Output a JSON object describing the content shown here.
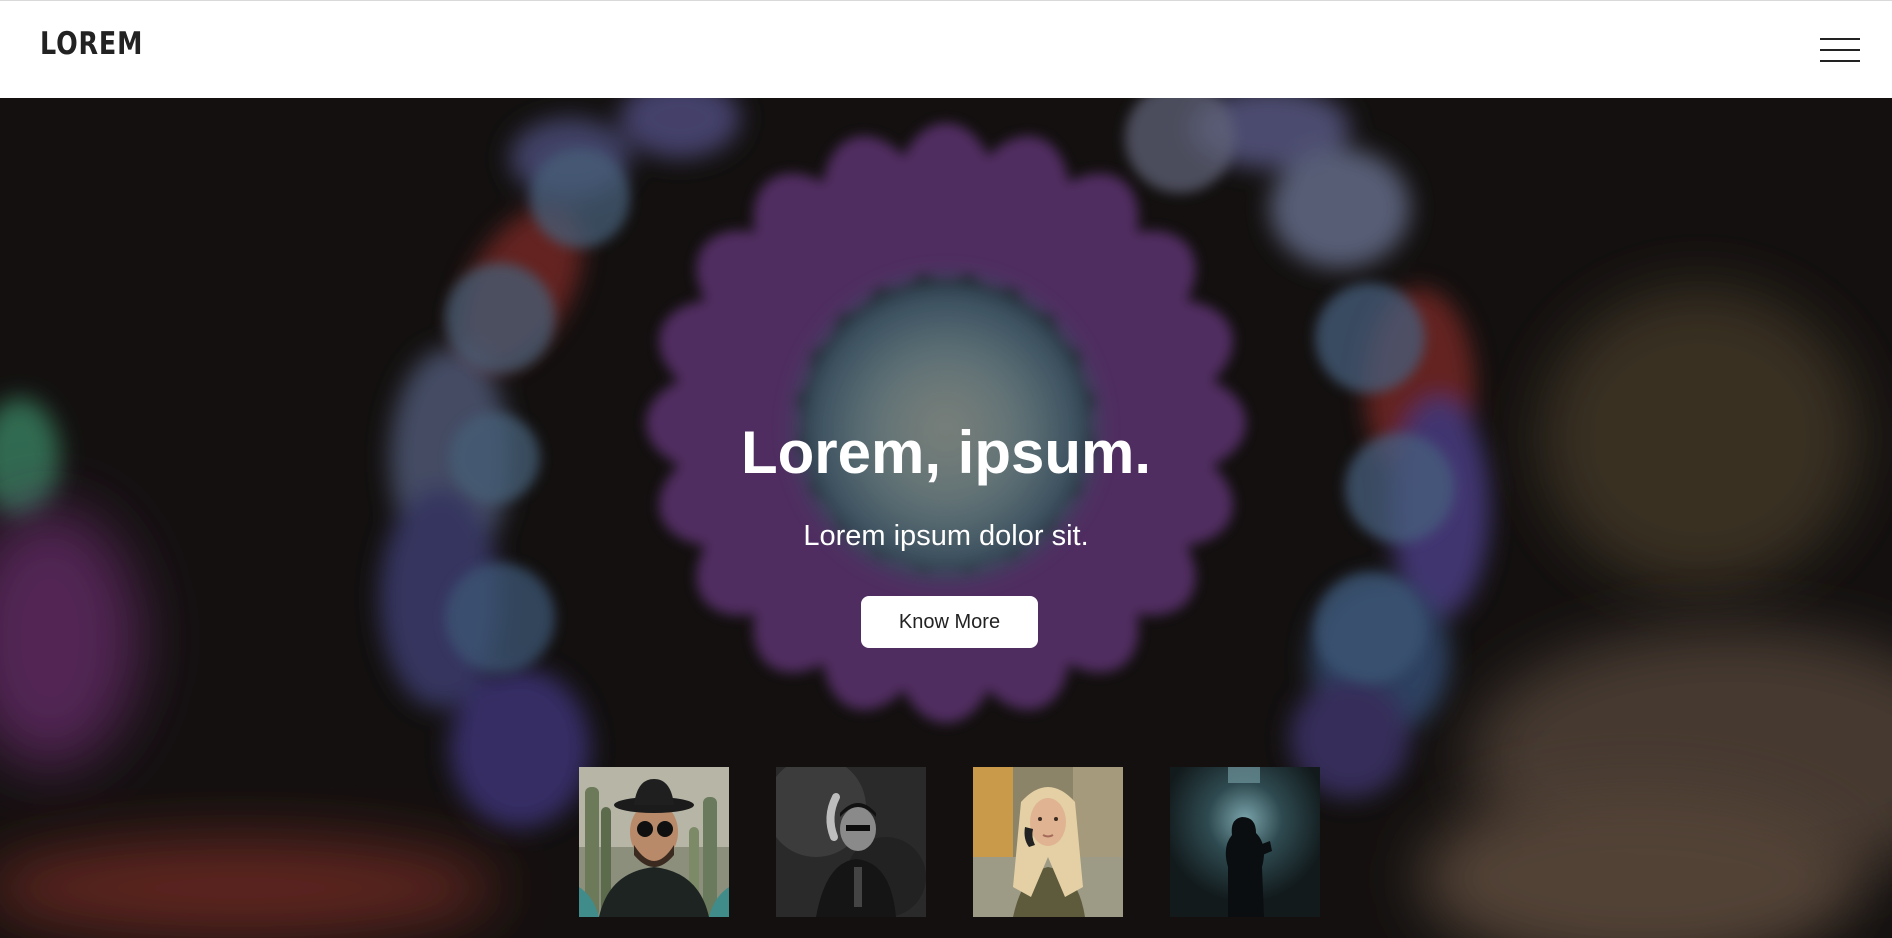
{
  "header": {
    "logo": "LOREM",
    "menu_icon": "hamburger-menu-icon"
  },
  "hero": {
    "title": "Lorem, ipsum.",
    "subtitle": "Lorem ipsum dolor sit.",
    "cta_label": "Know More",
    "background": "blurred bokeh photo with purple and blue lights"
  },
  "thumbnails": [
    {
      "subject": "man in hat and sunglasses among cacti"
    },
    {
      "subject": "man in black and white portrait"
    },
    {
      "subject": "blonde woman outdoors"
    },
    {
      "subject": "silhouette in dark room"
    }
  ],
  "colors": {
    "accent_purple": "#6c3a83",
    "bokeh_blue": "#5a86a8",
    "bokeh_red": "#9b3b35",
    "bg_dark": "#1a1614",
    "nav_bg": "#ffffff"
  }
}
